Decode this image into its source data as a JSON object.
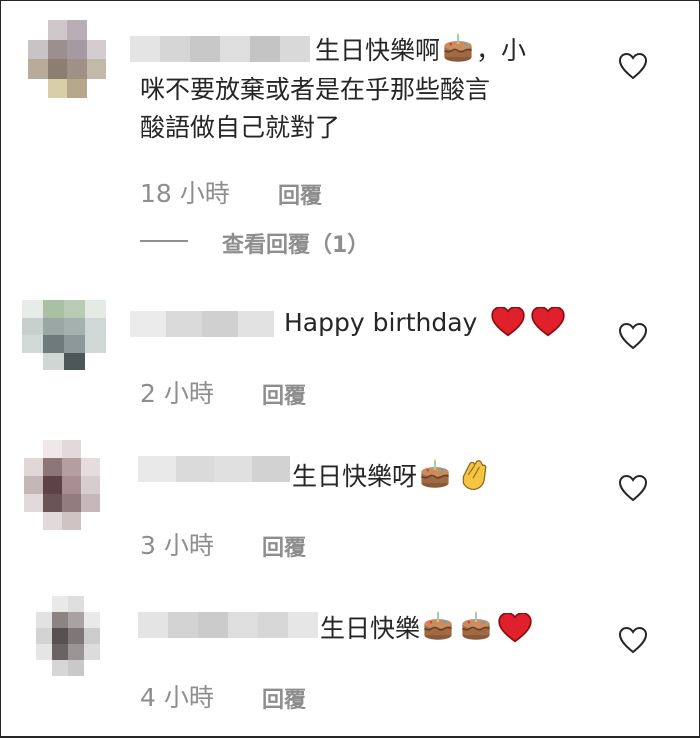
{
  "comments": [
    {
      "text_line1": "生日快樂啊",
      "text_line1_tail": "，小",
      "text_line2": "咪不要放棄或者是在乎那些酸言",
      "text_line3": "酸語做自己就對了",
      "time": "18 小時",
      "reply_label": "回覆",
      "view_replies_label": "查看回覆（1）"
    },
    {
      "text": "Happy birthday",
      "time": "2 小時",
      "reply_label": "回覆"
    },
    {
      "text": "生日快樂呀",
      "time": "3 小時",
      "reply_label": "回覆"
    },
    {
      "text": "生日快樂",
      "time": "4 小時",
      "reply_label": "回覆"
    }
  ],
  "icons": {
    "like": "heart-outline-icon",
    "cake": "birthday-cake-emoji",
    "red_heart": "red-heart-emoji",
    "clap": "clapping-hands-emoji"
  },
  "colors": {
    "text": "#262626",
    "secondary": "#8e8e8e",
    "heart_red": "#e0202a"
  }
}
